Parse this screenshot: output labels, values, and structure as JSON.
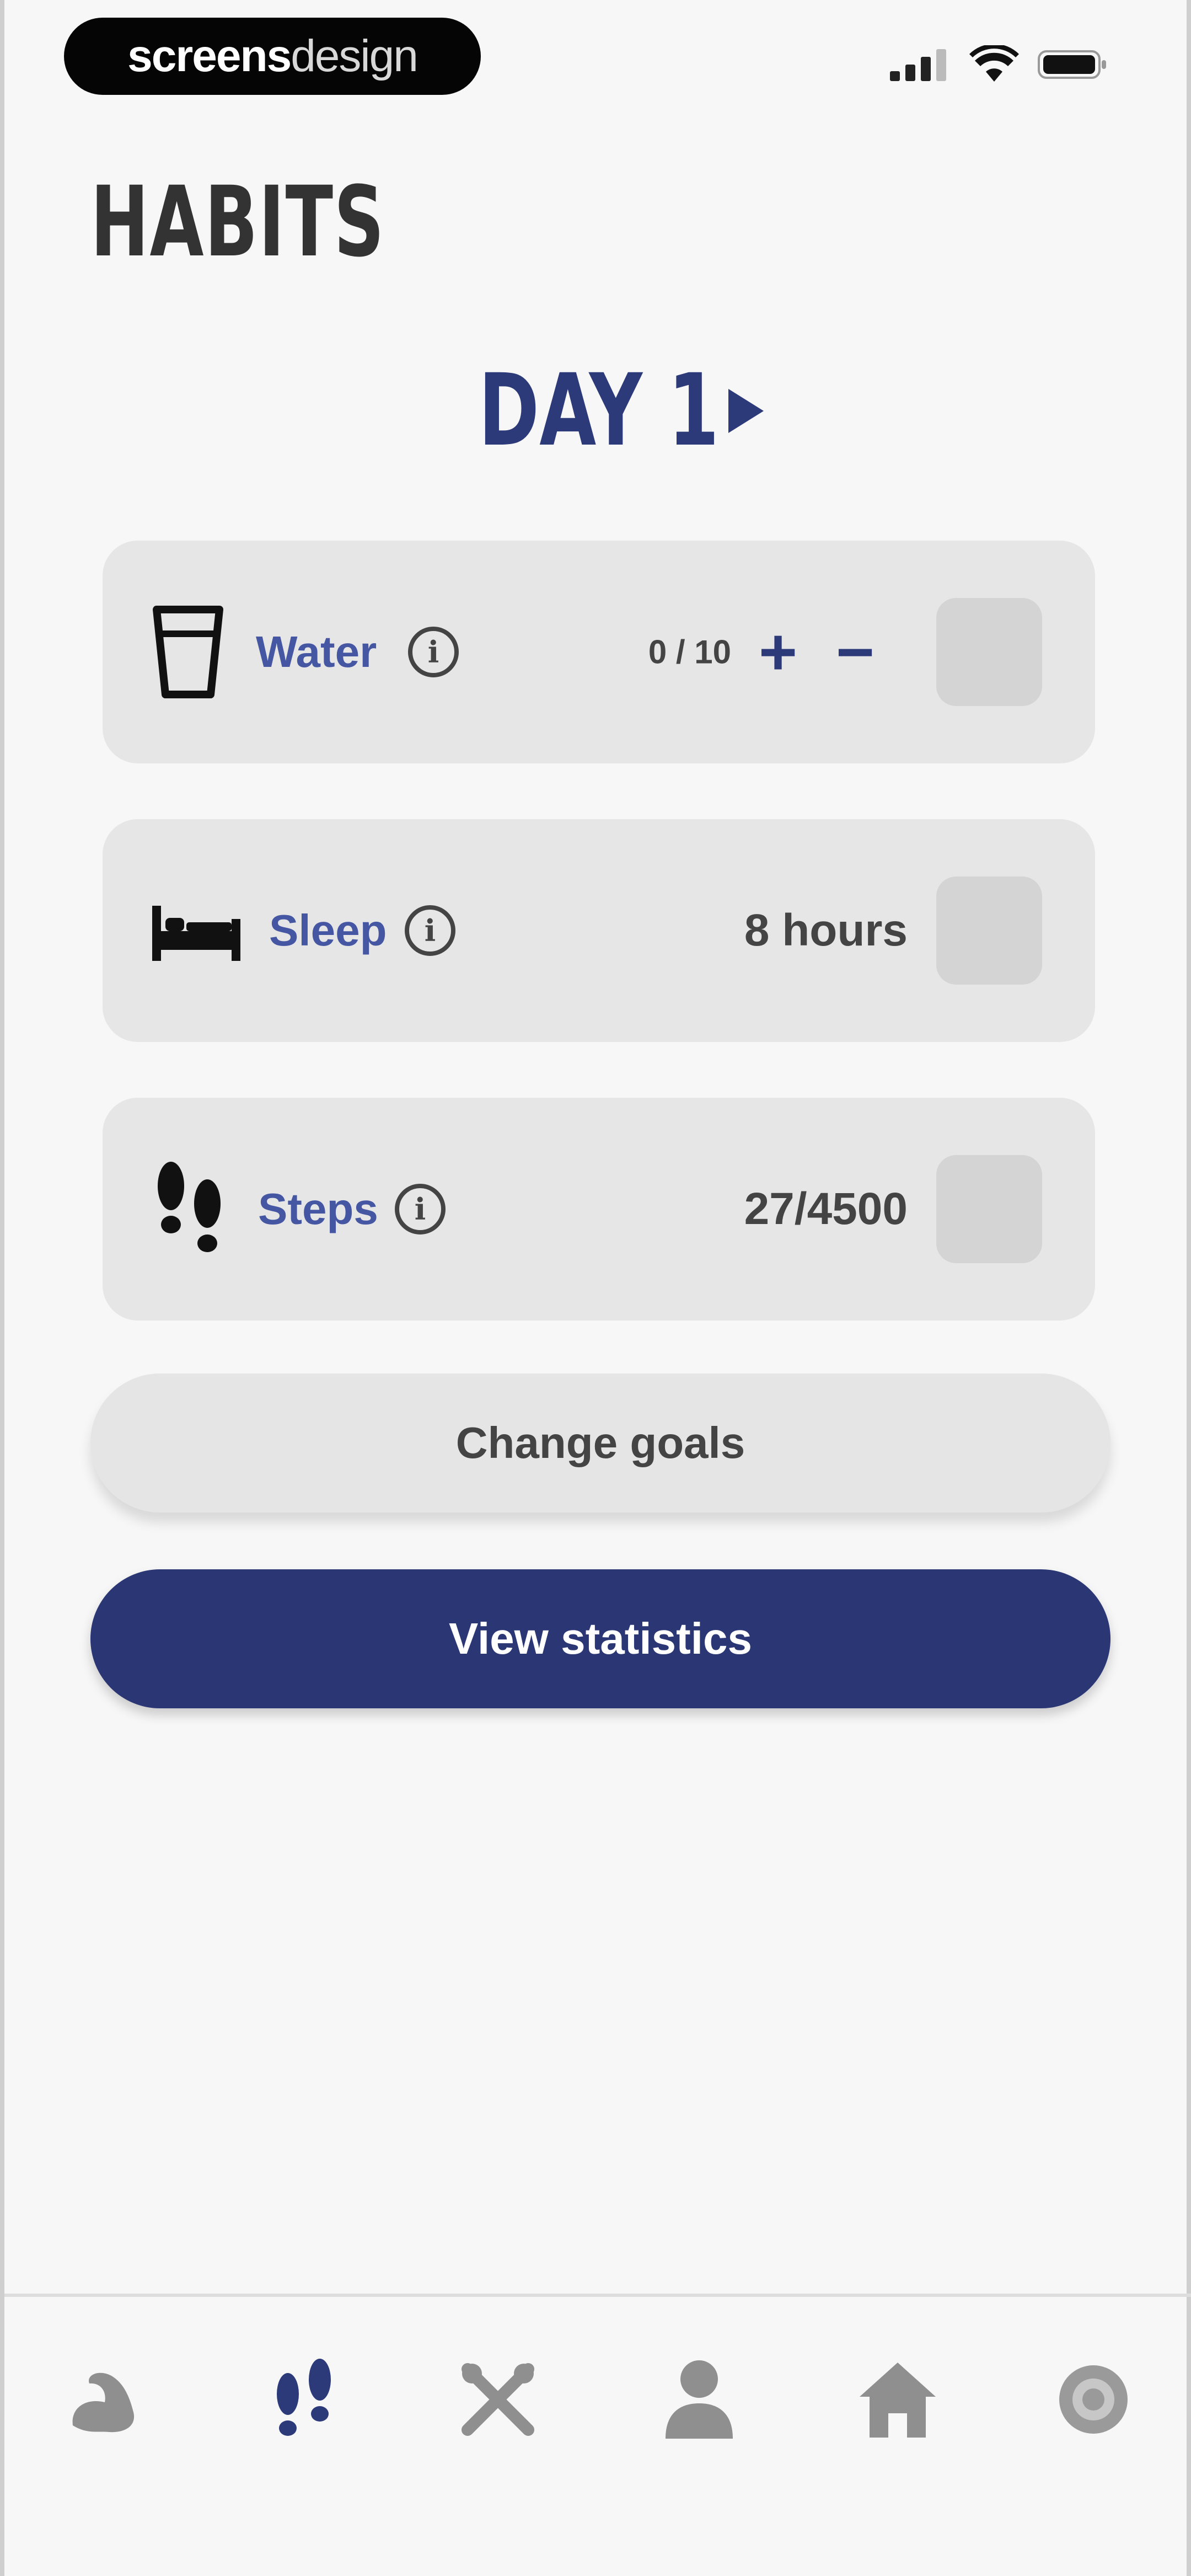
{
  "status_bar": {
    "brand_part1": "screens",
    "brand_part2": "design",
    "icons": [
      "cellular-signal-icon",
      "wifi-icon",
      "battery-icon"
    ]
  },
  "page": {
    "title": "HABITS",
    "day_label": "DAY 1"
  },
  "habits": [
    {
      "label": "Water",
      "value": "0 / 10",
      "icon": "cup-icon",
      "controls": [
        "+",
        "−"
      ]
    },
    {
      "label": "Sleep",
      "value": "8 hours",
      "icon": "bed-icon"
    },
    {
      "label": "Steps",
      "value": "27/4500",
      "icon": "footprints-icon"
    }
  ],
  "actions": {
    "change_goals": "Change goals",
    "view_statistics": "View statistics"
  },
  "bottom_nav": {
    "items": [
      "arm-icon",
      "footprints-icon",
      "utensils-icon",
      "person-icon",
      "home-icon",
      "settings-icon"
    ],
    "active": "footprints-icon"
  },
  "colors": {
    "accent": "#2b3675",
    "label_blue": "#4556a3",
    "card": "#e6e6e6",
    "background": "#f7f7f7"
  }
}
